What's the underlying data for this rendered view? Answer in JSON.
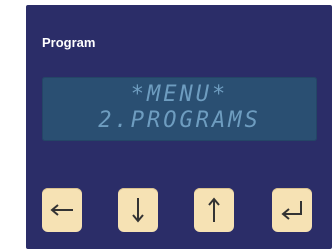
{
  "panel": {
    "label": "Program"
  },
  "display": {
    "line1": "*MENU*",
    "line2": "2.PROGRAMS"
  },
  "keys": [
    {
      "icon": "arrow-left-icon"
    },
    {
      "icon": "arrow-down-icon"
    },
    {
      "icon": "arrow-up-icon"
    },
    {
      "icon": "enter-return-icon"
    }
  ],
  "colors": {
    "panel": "#2b2d68",
    "lcd_bg": "#2a4f72",
    "lcd_text": "#6e9dc0",
    "key_bg": "#f6e2b4",
    "key_icon": "#333333"
  }
}
